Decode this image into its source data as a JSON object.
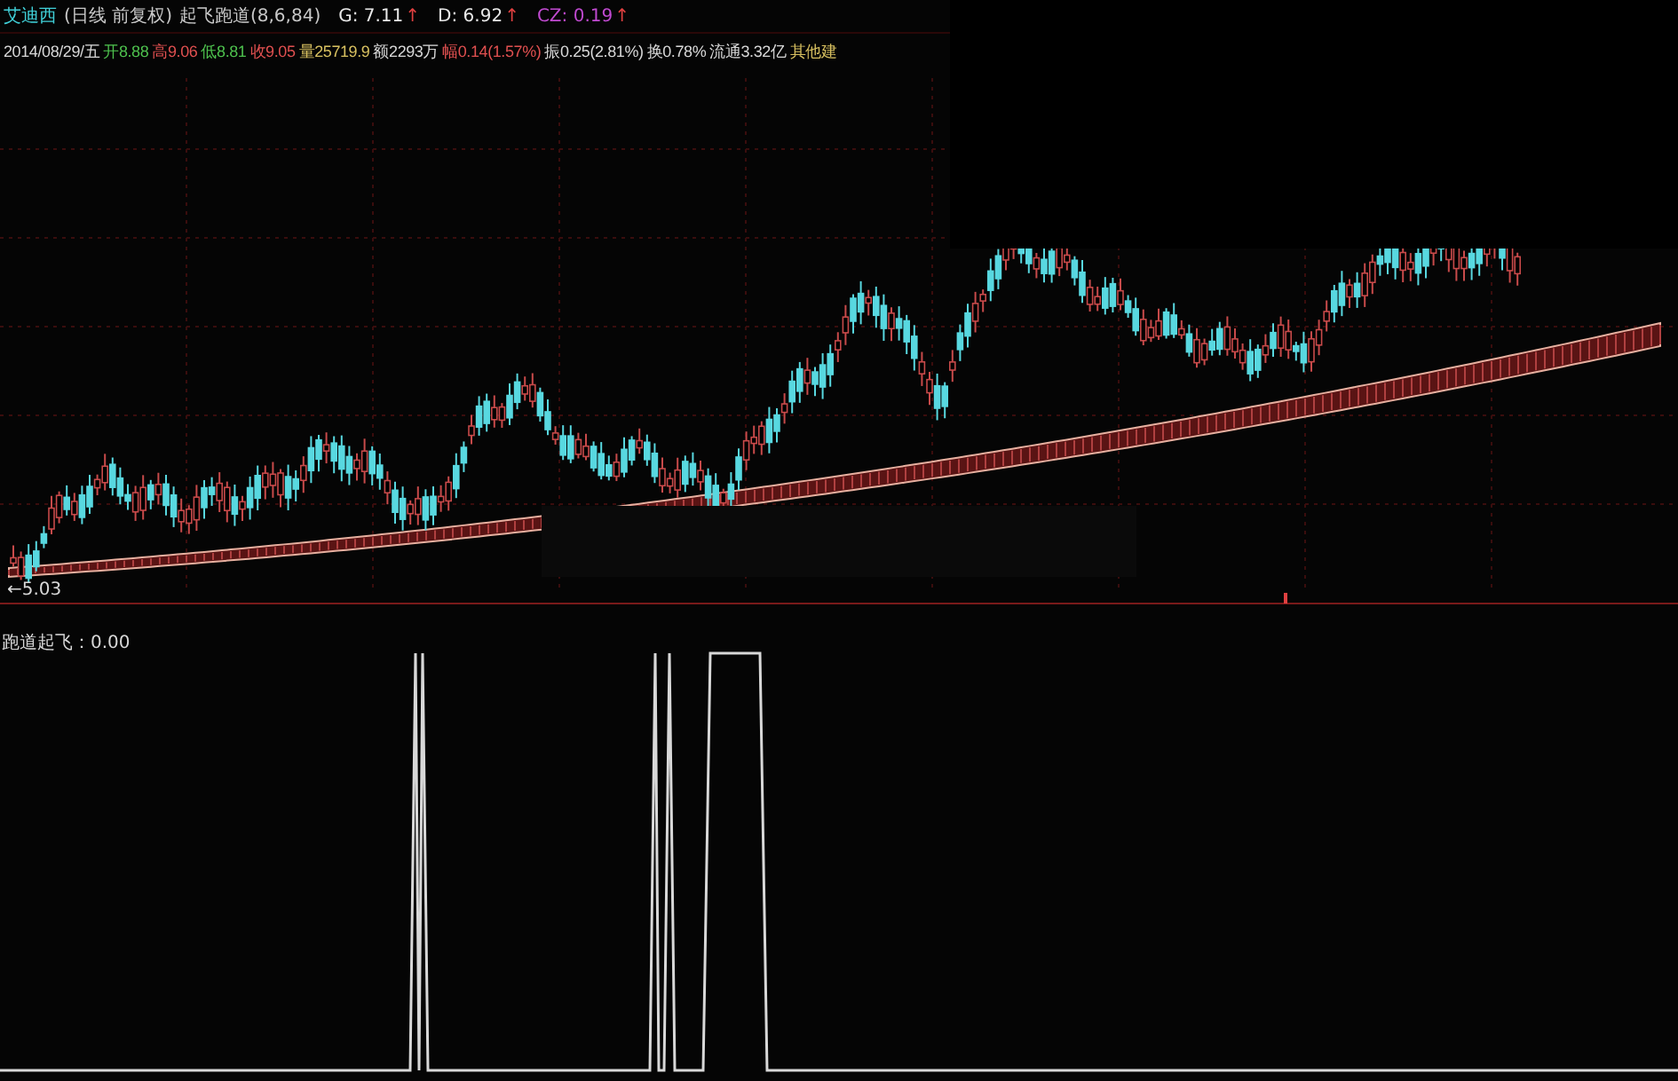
{
  "header": {
    "stock_name": "艾迪西",
    "period": "(日线 前复权)",
    "indicator": "起飞跑道(8,6,84)",
    "lines": [
      {
        "label": "G: 7.11",
        "arrow": "↑",
        "color": "#e8e8e8"
      },
      {
        "label": "D: 6.92",
        "arrow": "↑",
        "color": "#e8e8e8"
      },
      {
        "label": "CZ: 0.19",
        "arrow": "↑",
        "color": "#c04ad0"
      }
    ]
  },
  "quote": [
    {
      "text": "2014/08/29/五",
      "color": "#d8d8d8"
    },
    {
      "text": "开8.88",
      "color": "#4ec24e"
    },
    {
      "text": "高9.06",
      "color": "#e05050"
    },
    {
      "text": "低8.81",
      "color": "#4ec24e"
    },
    {
      "text": "收9.05",
      "color": "#e05050"
    },
    {
      "text": "量25719.9",
      "color": "#d8c060"
    },
    {
      "text": "额2293万",
      "color": "#d8d8d8"
    },
    {
      "text": "幅0.14(1.57%)",
      "color": "#e05050"
    },
    {
      "text": "振0.25(2.81%)",
      "color": "#d8d8d8"
    },
    {
      "text": "换0.78%",
      "color": "#d8d8d8"
    },
    {
      "text": "流通3.32亿",
      "color": "#d8d8d8"
    },
    {
      "text": "其他建",
      "color": "#d8c060"
    }
  ],
  "main_chart": {
    "low_marker": "←5.03"
  },
  "indicator_panel": {
    "readout": "跑道起飞：0.00"
  }
}
